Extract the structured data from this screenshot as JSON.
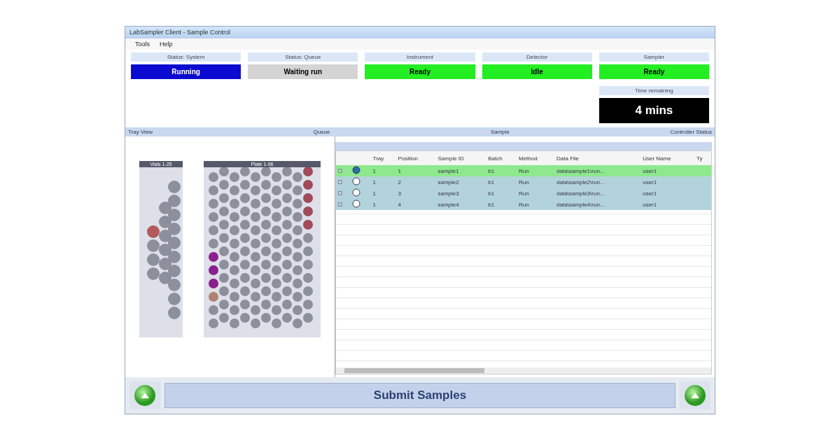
{
  "window": {
    "title": "LabSampler Client - Sample Control"
  },
  "menu": [
    "Tools",
    "Help"
  ],
  "status_tiles": [
    {
      "label": "Status: System",
      "value": "Running",
      "color": "#0a0ad0"
    },
    {
      "label": "Status: Queue",
      "value": "Waiting run",
      "color": "#d4d4d4"
    },
    {
      "label": "Instrument",
      "value": "Ready",
      "color": "#22ee22"
    },
    {
      "label": "Detector",
      "value": "Idle",
      "color": "#22ee22"
    },
    {
      "label": "Sampler",
      "value": "Ready",
      "color": "#22ee22"
    }
  ],
  "remaining": {
    "label": "Time remaining",
    "value": "4 mins"
  },
  "section_bar": {
    "left": "Tray View",
    "middle_left": "Queue",
    "middle": "Sample",
    "right": "Controller Status"
  },
  "racks": [
    {
      "title": "Vials 1-25"
    },
    {
      "title": "Plate 1-96"
    }
  ],
  "table": {
    "columns": [
      "Tray",
      "Position",
      "Sample ID",
      "Batch",
      "Method",
      "Data File",
      "User Name",
      "Ty"
    ],
    "rows": [
      {
        "selected": true,
        "running": true,
        "cells": [
          "1",
          "1",
          "sample1",
          "b1",
          "Run",
          "data\\sample1\\run...",
          "user1"
        ]
      },
      {
        "selected": false,
        "running": false,
        "cells": [
          "1",
          "2",
          "sample2",
          "b1",
          "Run",
          "data\\sample2\\run...",
          "user1"
        ]
      },
      {
        "selected": false,
        "running": false,
        "cells": [
          "1",
          "3",
          "sample3",
          "b1",
          "Run",
          "data\\sample3\\run...",
          "user1"
        ]
      },
      {
        "selected": false,
        "running": false,
        "cells": [
          "1",
          "4",
          "sample4",
          "b1",
          "Run",
          "data\\sample4\\run...",
          "user1"
        ]
      }
    ]
  },
  "submit": {
    "label": "Submit Samples"
  }
}
